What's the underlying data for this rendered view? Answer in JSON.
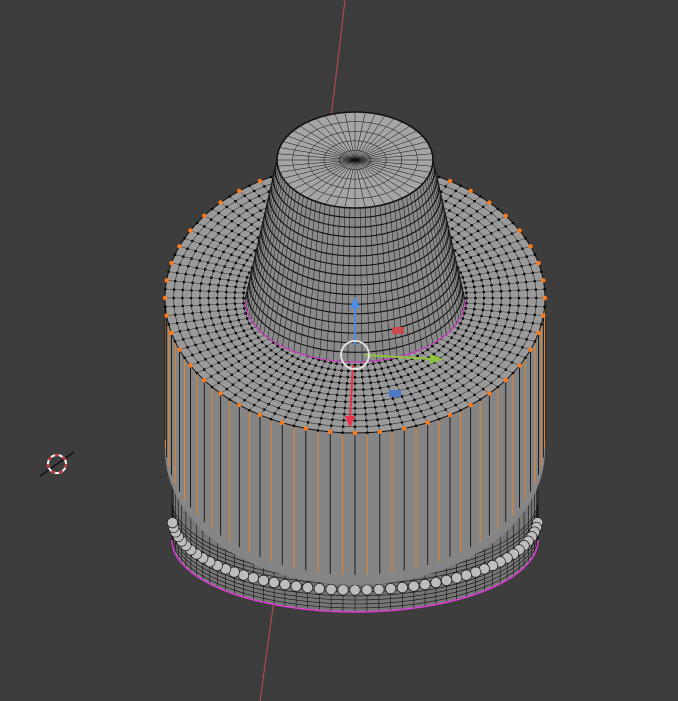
{
  "app": {
    "title": ""
  },
  "viewport": {
    "background": "#3d3d3d",
    "z_axis_color": "#a94a52",
    "mesh": {
      "face_fill": "#9a9a9a",
      "face_fill_dark": "#777777",
      "edge_color": "#111111",
      "vertex_color": "#000000",
      "selected_edge_color": "#e8872a",
      "selected_vertex_color": "#ff7a1a",
      "boundary_color": "#e33ad8",
      "vertex_face_fill": "#bdbdbd",
      "radial_segments": 96
    },
    "gizmo": {
      "x_axis_color": "#e8324a",
      "y_axis_color": "#8ec43c",
      "z_axis_color": "#4a8ce8",
      "small_label_color_red": "#c94a4a",
      "small_label_color_blue": "#4a7ac9",
      "center_ring_color": "#e0e0e0"
    },
    "cursor_3d": {
      "ring_color_a": "#ffffff",
      "ring_color_b": "#d23030",
      "crosshair_color": "#111111"
    }
  }
}
